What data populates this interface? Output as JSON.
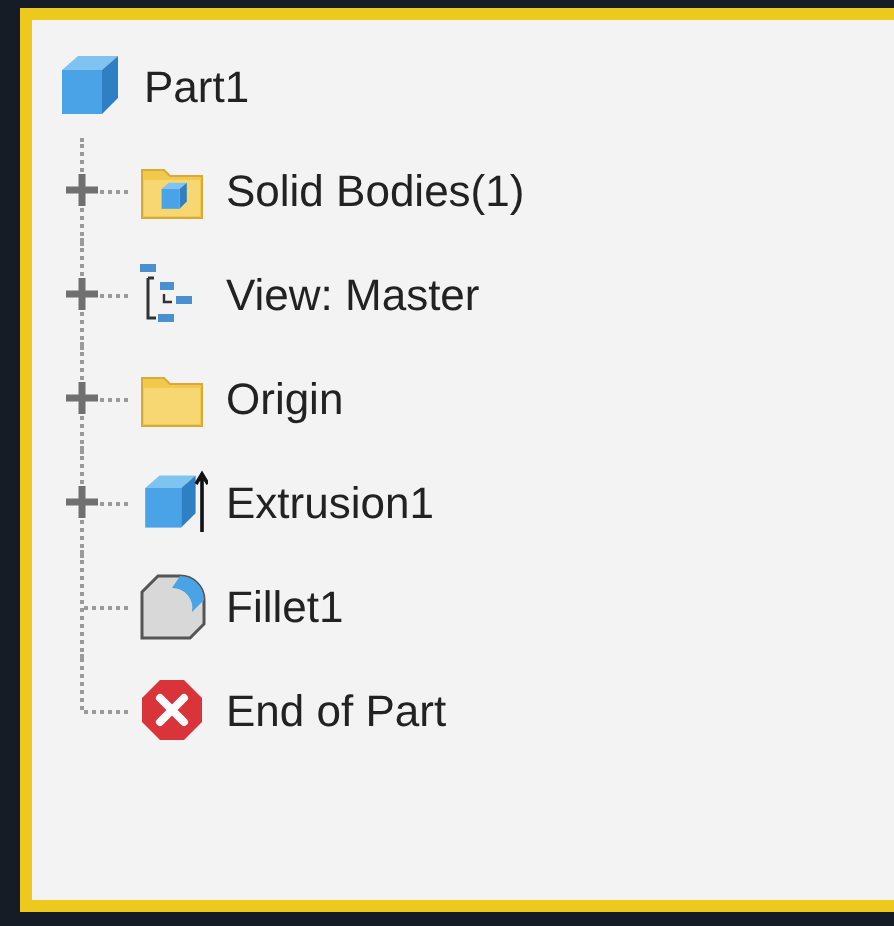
{
  "root": {
    "label": "Part1",
    "kind": "part"
  },
  "children": [
    {
      "label": "Solid Bodies(1)",
      "kind": "body-folder",
      "expandable": true
    },
    {
      "label": "View: Master",
      "kind": "view",
      "expandable": true
    },
    {
      "label": "Origin",
      "kind": "folder",
      "expandable": true
    },
    {
      "label": "Extrusion1",
      "kind": "extrusion",
      "expandable": true
    },
    {
      "label": "Fillet1",
      "kind": "fillet",
      "expandable": false
    },
    {
      "label": "End of Part",
      "kind": "end",
      "expandable": false
    }
  ]
}
